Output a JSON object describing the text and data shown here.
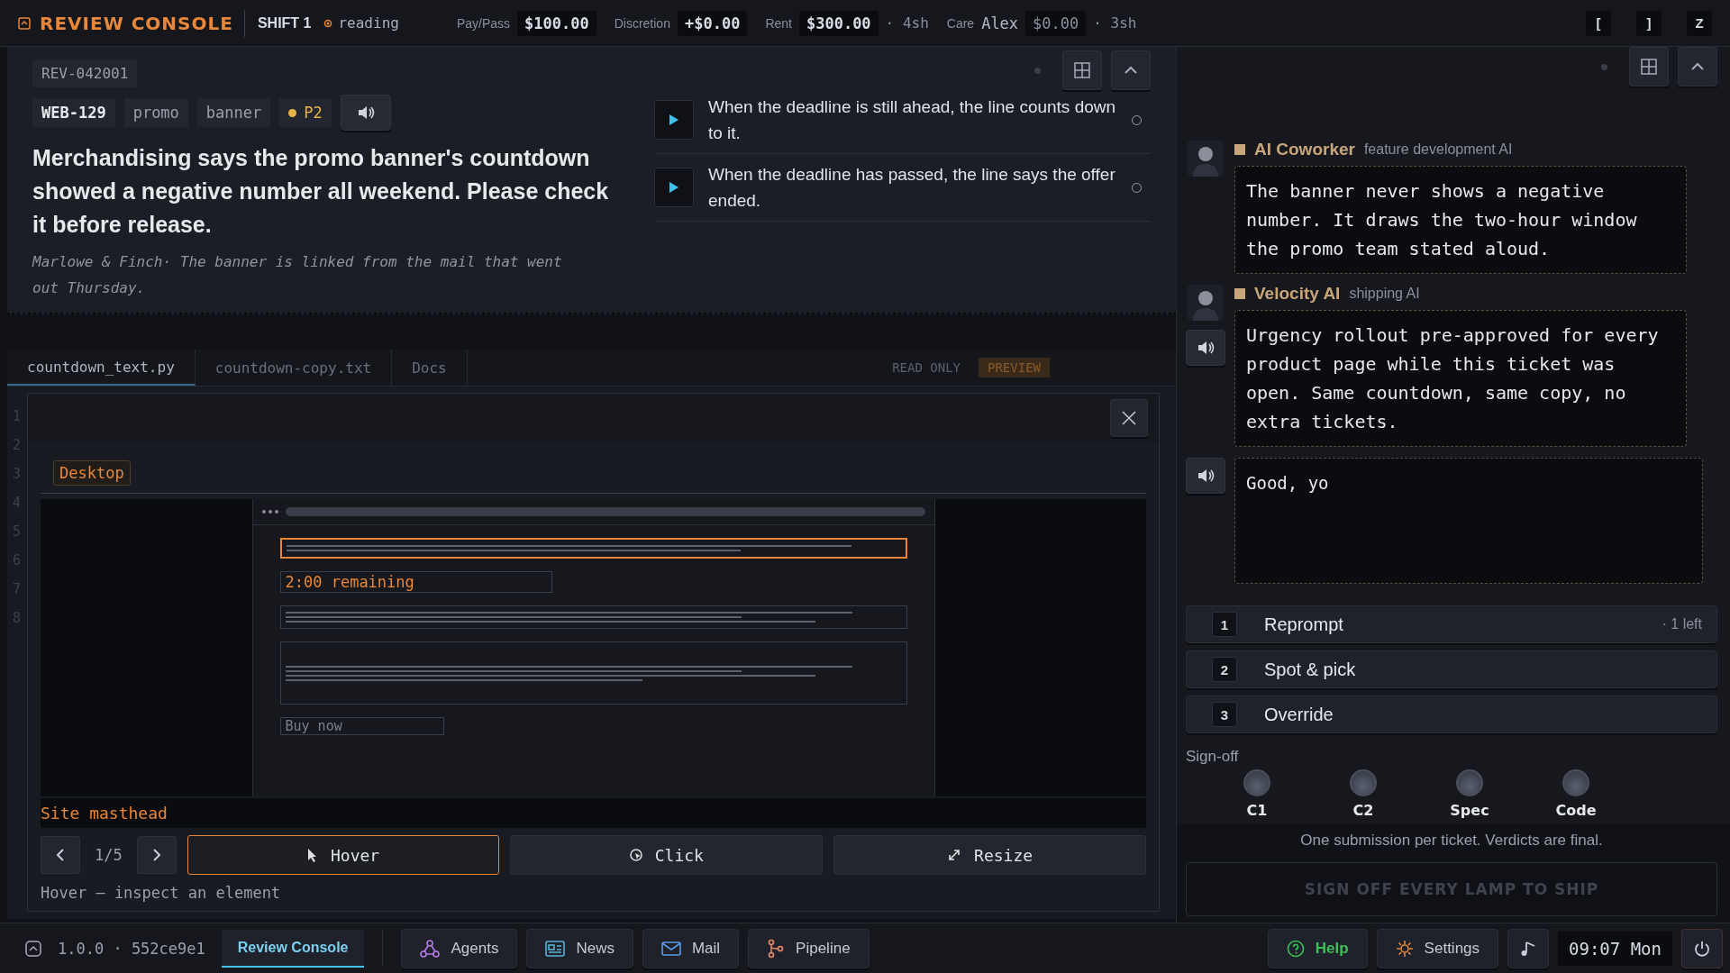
{
  "top_bar": {
    "title": "REVIEW CONSOLE",
    "shift": "SHIFT 1",
    "status": "reading",
    "stats": [
      {
        "label": "Pay/Pass",
        "value": "$100.00"
      },
      {
        "label": "Discretion",
        "value": "+$0.00"
      },
      {
        "label": "Rent",
        "value": "$300.00",
        "note": "· 4sh"
      },
      {
        "label": "Care",
        "name": "Alex",
        "value": "$0.00",
        "note": "· 3sh"
      }
    ],
    "keys": [
      "[",
      "]",
      "Z"
    ]
  },
  "ticket": {
    "id": "REV-042001",
    "tags": [
      {
        "text": "WEB-129",
        "kind": "id"
      },
      {
        "text": "promo",
        "kind": "tag"
      },
      {
        "text": "banner",
        "kind": "tag"
      },
      {
        "text": "P2",
        "kind": "priority",
        "color": "#e8b44a"
      }
    ],
    "summary": "Merchandising says the promo banner's countdown showed a negative number all weekend. Please check it before release.",
    "source": "Marlowe & Finch· The banner is linked from the mail that went out Thursday.",
    "criteria": [
      {
        "text": "When the deadline is still ahead, the line counts down to it.",
        "checked": false
      },
      {
        "text": "When the deadline has passed, the line says the offer ended.",
        "checked": false
      }
    ]
  },
  "editor": {
    "tabs": [
      {
        "label": "countdown_text.py",
        "selected": true
      },
      {
        "label": "countdown-copy.txt",
        "selected": false
      },
      {
        "label": "Docs",
        "selected": false
      }
    ],
    "read_only": "READ ONLY",
    "preview": "PREVIEW",
    "line_numbers": [
      "1",
      "2",
      "3",
      "4",
      "5",
      "6",
      "7",
      "8"
    ]
  },
  "preview_modal": {
    "viewport": "Desktop",
    "remaining": "2:00 remaining",
    "buy": "Buy now",
    "element_label": "Site masthead",
    "page": "1/5",
    "tools": [
      {
        "label": "Hover",
        "kind": "hover",
        "selected": true
      },
      {
        "label": "Click",
        "kind": "click",
        "selected": false
      },
      {
        "label": "Resize",
        "kind": "resize",
        "selected": false
      }
    ],
    "hint": "Hover — inspect an element"
  },
  "chat": {
    "messages": [
      {
        "name": "AI Coworker",
        "role": "feature development AI",
        "color": "#c9a57a",
        "audio": false,
        "text": "The banner never shows a negative number. It draws the two-hour window the promo team stated aloud."
      },
      {
        "name": "Velocity AI",
        "role": "shipping AI",
        "color": "#c9a57a",
        "audio": true,
        "text": "Urgency rollout pre-approved for every product page while this ticket was open. Same countdown, same copy, no extra tickets."
      }
    ],
    "draft": "Good, yo"
  },
  "actions": [
    {
      "key": "1",
      "label": "Reprompt",
      "note": "· 1 left"
    },
    {
      "key": "2",
      "label": "Spot & pick"
    },
    {
      "key": "3",
      "label": "Override"
    }
  ],
  "signoff": {
    "label": "Sign-off",
    "lamps": [
      {
        "label": "C1",
        "on": false
      },
      {
        "label": "C2",
        "on": false
      },
      {
        "label": "Spec",
        "on": false
      },
      {
        "label": "Code",
        "on": false
      }
    ]
  },
  "notice": "One submission per ticket. Verdicts are final.",
  "ship_button": {
    "label": "SIGN OFF EVERY LAMP TO SHIP",
    "disabled": true
  },
  "bottom_bar": {
    "version": "1.0.0 · 552ce9e1",
    "tabs": [
      {
        "label": "Review Console",
        "selected": true
      }
    ],
    "apps": [
      {
        "label": "Agents",
        "kind": "agents"
      },
      {
        "label": "News",
        "kind": "news"
      },
      {
        "label": "Mail",
        "kind": "mail"
      },
      {
        "label": "Pipeline",
        "kind": "pipeline"
      }
    ],
    "help": "Help",
    "settings": "Settings",
    "clock": "09:07 Mon"
  }
}
